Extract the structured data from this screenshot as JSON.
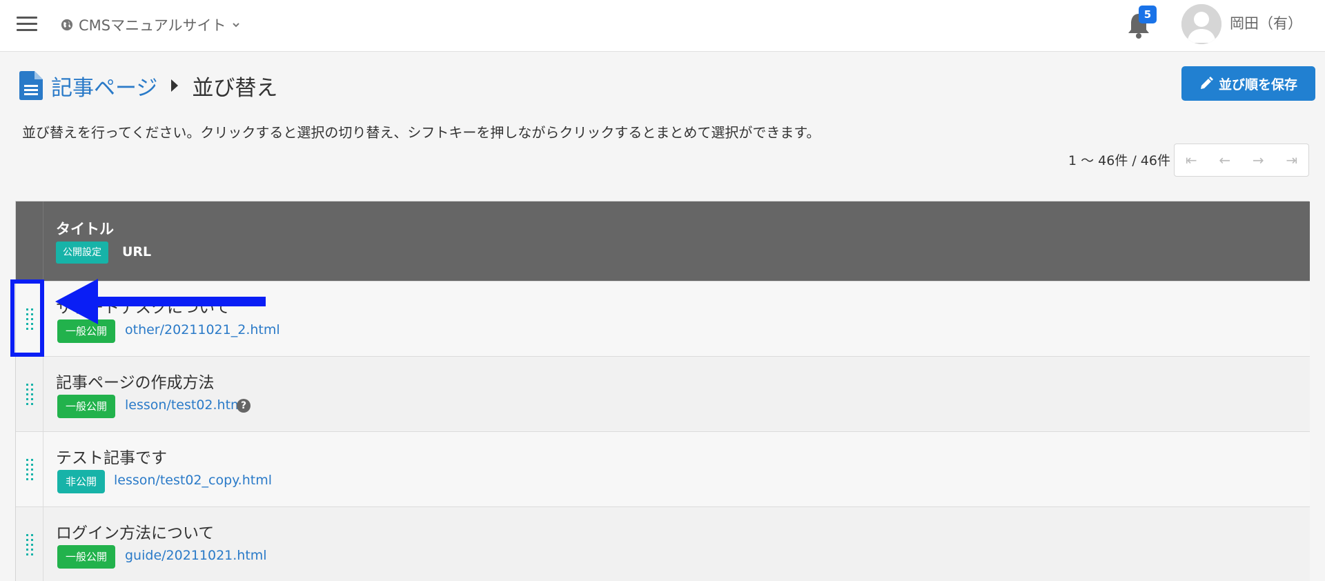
{
  "header": {
    "site_name": "CMSマニュアルサイト",
    "notification_count": "5",
    "username": "岡田（有）"
  },
  "page": {
    "breadcrumb_parent": "記事ページ",
    "breadcrumb_current": "並び替え",
    "save_button_label": "並び順を保存",
    "description": "並び替えを行ってください。クリックすると選択の切り替え、シフトキーを押しながらクリックするとまとめて選択ができます。",
    "pager_count": "1 〜 46件 / 46件",
    "pager_buttons": [
      "⇤",
      "←",
      "→",
      "⇥"
    ]
  },
  "table": {
    "header_title": "タイトル",
    "header_badge": "公開設定",
    "header_url": "URL",
    "rows": [
      {
        "title": "サポートデスクについて",
        "status": "一般公開",
        "url": "other/20211021_2.html"
      },
      {
        "title": "記事ページの作成方法",
        "status": "一般公開",
        "url": "lesson/test02.html",
        "help": "?"
      },
      {
        "title": "テスト記事です",
        "status": "非公開",
        "url": "lesson/test02_copy.html"
      },
      {
        "title": "ログイン方法について",
        "status": "一般公開",
        "url": "guide/20211021.html"
      }
    ]
  },
  "colors": {
    "accent_blue": "#2180d1",
    "link_blue": "#2a7ac8",
    "public_green": "#22b24c",
    "private_teal": "#17b3a8",
    "annotation_blue": "#0a1ef5"
  }
}
